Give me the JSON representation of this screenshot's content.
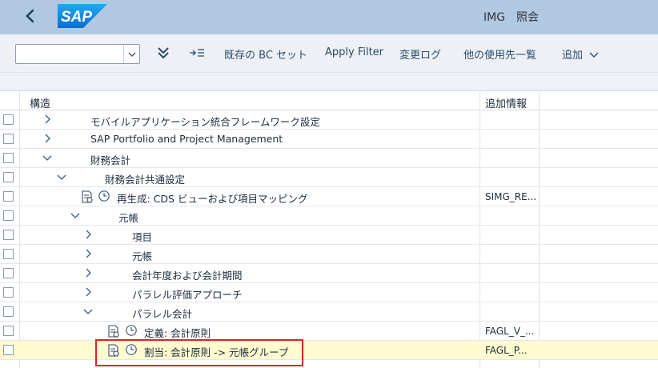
{
  "shellbar": {
    "title": "IMG　照会"
  },
  "toolbar": {
    "combo_value": "",
    "bc_set": "既存の BC セット",
    "apply_filter": "Apply Filter",
    "change_log": "変更ログ",
    "where_used": "他の使用先一覧",
    "add": "追加"
  },
  "table": {
    "columns": [
      "構造",
      "追加情報"
    ],
    "rows": [
      {
        "label": "モバイルアプリケーション統合フレームワーク設定",
        "info": "",
        "expanded": false
      },
      {
        "label": "SAP Portfolio and Project Management",
        "info": "",
        "expanded": false
      },
      {
        "label": "財務会計",
        "info": "",
        "expanded": true
      },
      {
        "label": "財務会計共通設定",
        "info": "",
        "expanded": true
      },
      {
        "label": "再生成: CDS ビューおよび項目マッピング",
        "info": "SIMG_RE...",
        "expanded": null
      },
      {
        "label": "元帳",
        "info": "",
        "expanded": true
      },
      {
        "label": "項目",
        "info": "",
        "expanded": false
      },
      {
        "label": "元帳",
        "info": "",
        "expanded": false
      },
      {
        "label": "会計年度および会計期間",
        "info": "",
        "expanded": false
      },
      {
        "label": "パラレル評価アプローチ",
        "info": "",
        "expanded": false
      },
      {
        "label": "パラレル会計",
        "info": "",
        "expanded": true
      },
      {
        "label": "定義: 会計原則",
        "info": "FAGL_V_...",
        "expanded": null
      },
      {
        "label": "割当: 会計原則 -> 元帳グループ",
        "info": "FAGL_P...",
        "expanded": null
      }
    ]
  }
}
